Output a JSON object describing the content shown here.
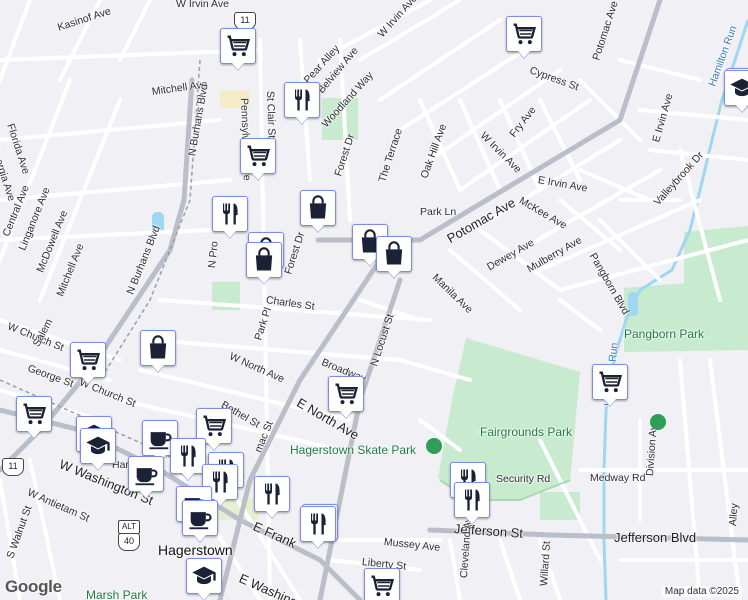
{
  "map": {
    "attribution": "Map data ©2025",
    "logo": "Google",
    "colors": {
      "background": "#f1f0f4",
      "road": "#ffffff",
      "major_road": "#b9bec9",
      "park": "#c8ebd0",
      "water": "#9fd6f2",
      "pin_border": "#7b8cf0",
      "pin_icon": "#1c2236"
    }
  },
  "streets": {
    "w_irvin_ave_top": "W Irvin Ave",
    "kasinof_ave": "Kasinof Ave",
    "mitchell_ave_top": "Mitchell Ave",
    "n_burhans_blvd_top": "N Burhans Blvd",
    "st_clair_st": "St Clair St",
    "pennsylvania_ave": "Pennsylvania Ave",
    "pear_alley": "Pear Alley",
    "belview_ave": "Belview Ave",
    "woodland_way": "Woodland Way",
    "forest_dr_top": "Forest Dr",
    "the_terrace": "The Terrace",
    "oak_hill_ave": "Oak Hill Ave",
    "w_irvin_ave_mid": "W Irvin Ave",
    "w_irvin_ave_right": "W Irvin Ave",
    "fry_ave": "Fry Ave",
    "cypress_st": "Cypress St",
    "potomac_ave_top": "Potomac Ave",
    "e_irvin_ave_top": "E Irvin Ave",
    "hamilton_run": "Hamilton Run",
    "florida_ave": "Florida Ave",
    "georgia_ave": "Georgia Ave",
    "central_ave": "Central Ave",
    "linganore_ave": "Linganore Ave",
    "mcdowell_ave": "McDowell Ave",
    "mitchell_ave_low": "Mitchell Ave",
    "n_burhans_blvd": "N Burhans Blvd",
    "n_prospect": "N Pro",
    "forest_dr": "Forest Dr",
    "park_ln": "Park Ln",
    "potomac_ave": "Potomac Ave",
    "mckee_ave": "McKee Ave",
    "e_irvin_ave": "E Irvin Ave",
    "valleybrook_dr": "Valleybrook Dr",
    "dewey_ave": "Dewey Ave",
    "mulberry_ave": "Mulberry Ave",
    "pangborn_blvd": "Pangborn Blvd",
    "manila_ave": "Manila Ave",
    "charles_st": "Charles St",
    "park_pl": "Park Pl",
    "w_north_ave": "W North Ave",
    "w_church_st": "W Church St",
    "salem_ave": "Salem",
    "george_st": "George St",
    "w_church_st_low": "W Church St",
    "broadway": "Broadway",
    "n_locust_st": "N Locust St",
    "e_north_ave": "E North Ave",
    "bethel_st": "Bethel St",
    "potomac_st": "mac St",
    "w_washington_st": "W Washington St",
    "w_antietam_st": "W Antietam St",
    "s_walnut_st": "S Walnut St",
    "e_franklin": "E Frank",
    "e_washington": "E Washing",
    "mussey_ave": "Mussey Ave",
    "liberty_st": "Liberty St",
    "jefferson_st": "Jefferson St",
    "jefferson_blvd": "Jefferson Blvd",
    "security_rd": "Security Rd",
    "medway_rd": "Medway Rd",
    "division_ave": "Division Ave",
    "willard_st": "Willard St",
    "cleveland_ave": "Cleveland Ave",
    "alley": "Alley",
    "hamilton_run_low": "Hamilton Run",
    "pangborn_park": "Pangborn Park",
    "fairgrounds_park": "Fairgrounds Park",
    "hagerstown_skate_park": "Hagerstown Skate Park",
    "hagerstown": "Hagerstown",
    "harper": "Har",
    "marsh_park": "Marsh Park",
    "route_11": "11",
    "route_alt": "ALT",
    "route_40": "40"
  },
  "pins": [
    {
      "type": "grocery",
      "icon": "shopping-cart-icon"
    },
    {
      "type": "grocery",
      "icon": "shopping-cart-icon"
    },
    {
      "type": "restaurant",
      "icon": "fork-knife-icon"
    },
    {
      "type": "grocery",
      "icon": "shopping-cart-icon"
    },
    {
      "type": "shopping",
      "icon": "shopping-bag-icon"
    },
    {
      "type": "restaurant",
      "icon": "fork-knife-icon"
    },
    {
      "type": "shopping",
      "icon": "shopping-bag-icon"
    },
    {
      "type": "shopping",
      "icon": "shopping-bag-icon"
    },
    {
      "type": "shopping",
      "icon": "shopping-bag-icon"
    },
    {
      "type": "shopping",
      "icon": "shopping-bag-icon"
    },
    {
      "type": "grocery",
      "icon": "shopping-cart-icon"
    },
    {
      "type": "shopping",
      "icon": "shopping-bag-icon"
    },
    {
      "type": "grocery",
      "icon": "shopping-cart-icon"
    },
    {
      "type": "grocery",
      "icon": "shopping-cart-icon"
    },
    {
      "type": "grocery",
      "icon": "shopping-cart-icon"
    },
    {
      "type": "school",
      "icon": "school-icon"
    },
    {
      "type": "school",
      "icon": "school-icon"
    },
    {
      "type": "cafe",
      "icon": "coffee-cup-icon"
    },
    {
      "type": "grocery",
      "icon": "shopping-cart-icon"
    },
    {
      "type": "restaurant",
      "icon": "fork-knife-icon"
    },
    {
      "type": "restaurant",
      "icon": "fork-knife-icon"
    },
    {
      "type": "cafe",
      "icon": "coffee-cup-icon"
    },
    {
      "type": "restaurant",
      "icon": "fork-knife-icon"
    },
    {
      "type": "restaurant",
      "icon": "fork-knife-icon"
    },
    {
      "type": "cafe",
      "icon": "coffee-cup-icon"
    },
    {
      "type": "cafe",
      "icon": "coffee-cup-icon"
    },
    {
      "type": "restaurant",
      "icon": "fork-knife-icon"
    },
    {
      "type": "restaurant",
      "icon": "fork-knife-icon"
    },
    {
      "type": "cafe",
      "icon": "coffee-cup-icon"
    },
    {
      "type": "school",
      "icon": "school-icon"
    },
    {
      "type": "grocery",
      "icon": "shopping-cart-icon"
    },
    {
      "type": "shopping",
      "icon": "shopping-bag-icon"
    },
    {
      "type": "restaurant",
      "icon": "fork-knife-icon"
    },
    {
      "type": "grocery",
      "icon": "shopping-cart-icon"
    },
    {
      "type": "school",
      "icon": "school-icon"
    }
  ]
}
